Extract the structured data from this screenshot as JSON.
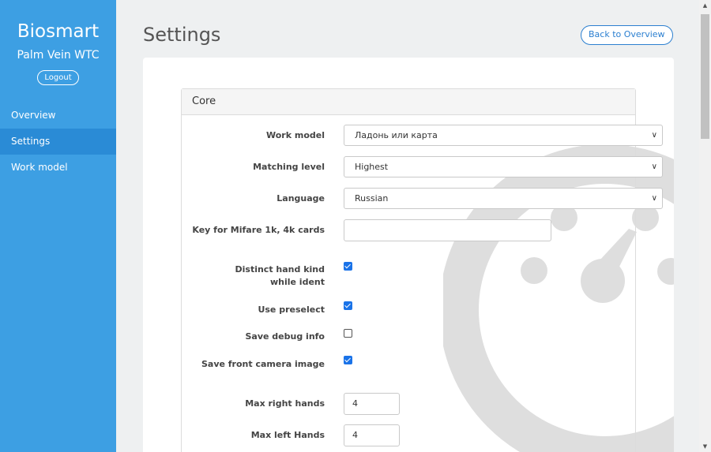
{
  "sidebar": {
    "brand_title": "Biosmart",
    "brand_subtitle": "Palm Vein WTC",
    "logout_label": "Logout",
    "nav": [
      {
        "label": "Overview",
        "active": false
      },
      {
        "label": "Settings",
        "active": true
      },
      {
        "label": "Work model",
        "active": false
      }
    ]
  },
  "header": {
    "title": "Settings",
    "back_label": "Back to Overview"
  },
  "panel": {
    "title": "Core",
    "fields": {
      "work_model": {
        "label": "Work model",
        "value": "Ладонь или карта"
      },
      "matching_level": {
        "label": "Matching level",
        "value": "Highest"
      },
      "language": {
        "label": "Language",
        "value": "Russian"
      },
      "mifare_key": {
        "label": "Key for Mifare 1k, 4k cards",
        "value": ""
      },
      "distinct_hand": {
        "label": "Distinct hand kind while ident",
        "checked": true
      },
      "use_preselect": {
        "label": "Use preselect",
        "checked": true
      },
      "save_debug": {
        "label": "Save debug info",
        "checked": false
      },
      "save_front_camera": {
        "label": "Save front camera image",
        "checked": true
      },
      "max_right_hands": {
        "label": "Max right hands",
        "value": "4"
      },
      "max_left_hands": {
        "label": "Max left Hands",
        "value": "4"
      }
    }
  },
  "icons": {
    "select_chevron": "chevron-down-icon",
    "watermark": "gauge-icon"
  },
  "colors": {
    "sidebar": "#3d9fe3",
    "sidebar_active": "#2a8bd6",
    "accent": "#2b7fd0",
    "checkbox": "#1a73e8"
  }
}
